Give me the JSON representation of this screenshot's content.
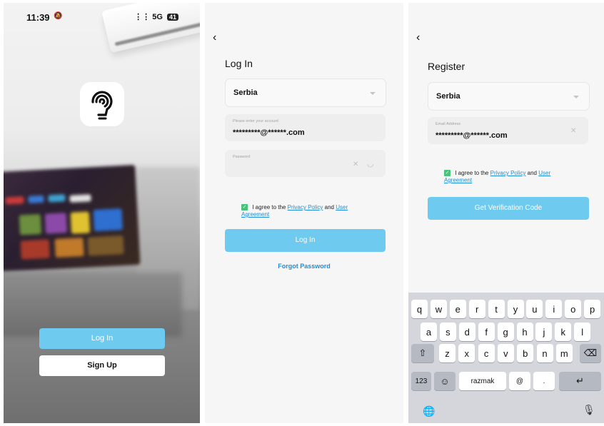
{
  "splash": {
    "time": "11:39",
    "network": "5G",
    "battery": "41",
    "login_label": "Log In",
    "signup_label": "Sign Up"
  },
  "login": {
    "title": "Log In",
    "country": "Serbia",
    "account_placeholder": "Please enter your account",
    "account_value": "*********@******.com",
    "password_placeholder": "Password",
    "agree_prefix": "I agree to the",
    "privacy_link": "Privacy Policy",
    "and_text": "and",
    "user_link": "User",
    "agreement_link": "Agreement",
    "login_button": "Log In",
    "forgot_link": "Forgot Password"
  },
  "register": {
    "title": "Register",
    "country": "Serbia",
    "email_placeholder": "Email Address",
    "email_value": "*********@******.com",
    "agree_prefix": "I agree to the",
    "privacy_link": "Privacy Policy",
    "and_text": "and",
    "user_link": "User",
    "agreement_link": "Agreement",
    "code_button": "Get Verification Code"
  },
  "keyboard": {
    "row1": [
      "q",
      "w",
      "e",
      "r",
      "t",
      "y",
      "u",
      "i",
      "o",
      "p"
    ],
    "row2": [
      "a",
      "s",
      "d",
      "f",
      "g",
      "h",
      "j",
      "k",
      "l"
    ],
    "row3": [
      "z",
      "x",
      "c",
      "v",
      "b",
      "n",
      "m"
    ],
    "numbers_key": "123",
    "space_key": "razmak",
    "at_key": "@",
    "dot_key": "."
  },
  "icons": {
    "back": "chevron-left-icon",
    "clear": "close-icon",
    "eye": "eye-closed-icon",
    "shift": "shift-icon",
    "delete": "backspace-icon",
    "emoji": "emoji-icon",
    "return": "return-icon",
    "globe": "globe-icon",
    "mic": "microphone-icon"
  },
  "colors": {
    "accent": "#6fcaf0",
    "link": "#1e8fd6",
    "checkbox": "#49c27a"
  }
}
